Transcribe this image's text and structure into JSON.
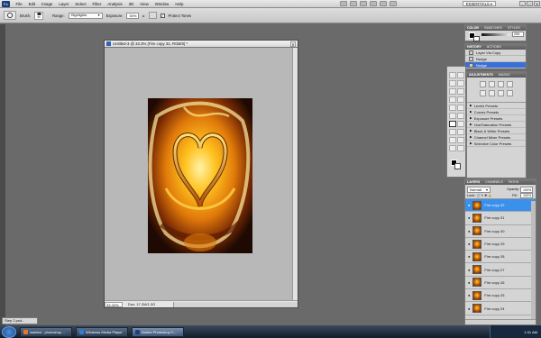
{
  "menubar": {
    "app_icon": "Ps",
    "items": [
      "File",
      "Edit",
      "Image",
      "Layer",
      "Select",
      "Filter",
      "Analysis",
      "3D",
      "View",
      "Window",
      "Help"
    ],
    "workspace": "ESSENTIALS ▾",
    "window_controls": [
      "–",
      "□",
      "✕"
    ]
  },
  "options": {
    "brush_label": "Brush:",
    "brush_size": "65",
    "range_label": "Range:",
    "range_value": "Highlights",
    "exposure_label": "Exposure:",
    "exposure_value": "50%",
    "protect_label": "Protect Tones",
    "protect_checked": "✓"
  },
  "document": {
    "title": "Untitled-3 @ 33.3% (Fire copy 32, RGB/8) *",
    "close": "✕",
    "zoom": "33.33%",
    "doc_info": "Doc: 17.2M/1.3G"
  },
  "color_panel": {
    "tabs": [
      "COLOR",
      "SWATCHES",
      "STYLES"
    ],
    "value": "255"
  },
  "history_panel": {
    "tabs": [
      "HISTORY",
      "ACTIONS"
    ],
    "items": [
      "Layer Via Copy",
      "Nudge",
      "Layer Via Copy",
      "Nudge"
    ],
    "active_index": 3
  },
  "adjustments_panel": {
    "tabs": [
      "ADJUSTMENTS",
      "MASKS"
    ],
    "presets": [
      "Levels Presets",
      "Curves Presets",
      "Exposure Presets",
      "Hue/Saturation Presets",
      "Black & White Presets",
      "Channel Mixer Presets",
      "Selective Color Presets"
    ]
  },
  "layers_panel": {
    "tabs": [
      "LAYERS",
      "CHANNELS",
      "PATHS"
    ],
    "blend_mode": "Normal",
    "opacity_label": "Opacity:",
    "opacity": "100%",
    "lock_label": "Lock:",
    "fill_label": "Fill:",
    "fill": "100%",
    "layers": [
      "Fire copy 32",
      "Fire copy 31",
      "Fire copy 30",
      "Fire copy 29",
      "Fire copy 28",
      "Fire copy 27",
      "Fire copy 26",
      "Fire copy 25",
      "Fire copy 24"
    ],
    "active_index": 0
  },
  "minimized_doc": "Step 2.psd...",
  "taskbar": {
    "buttons": [
      "wanted - photoshop ...",
      "Windows Media Player",
      "Adobe Photoshop C..."
    ],
    "clock": "1:31 AM"
  },
  "colors": {
    "accent": "#3a90ea",
    "fire_light": "#ffd23a",
    "fire_mid": "#d06a06",
    "fire_dark": "#2b0f05"
  }
}
